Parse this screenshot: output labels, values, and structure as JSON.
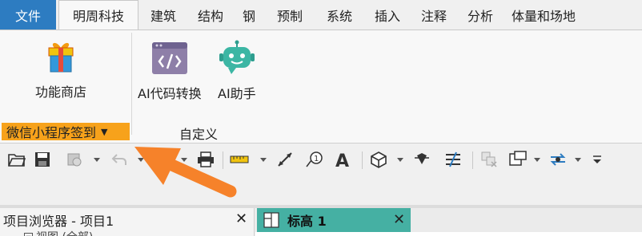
{
  "ribbon": {
    "tabs": [
      "文件",
      "明周科技",
      "建筑",
      "结构",
      "钢",
      "预制",
      "系统",
      "插入",
      "注释",
      "分析",
      "体量和场地"
    ],
    "active_tab": "明周科技"
  },
  "panel": {
    "buttons": [
      {
        "label": "功能商店",
        "icon": "gift-box-icon"
      },
      {
        "label": "AI代码转换",
        "icon": "code-window-icon"
      },
      {
        "label": "AI助手",
        "icon": "robot-icon"
      }
    ],
    "group_orange_label": "微信小程序签到",
    "group_label": "自定义"
  },
  "qat": {
    "icons": [
      "open-folder-icon",
      "save-icon",
      "sync-icon",
      "undo-icon",
      "redo-icon",
      "print-icon",
      "measure-icon",
      "dimension-icon",
      "tag-icon",
      "text-icon",
      "3d-view-icon",
      "section-icon",
      "thin-lines-icon",
      "close-hidden-icon",
      "switch-windows-icon",
      "user-interface-icon"
    ]
  },
  "browser": {
    "title": "项目浏览器 - 项目1",
    "row_label": "视图 (全部)",
    "close": "✕"
  },
  "document": {
    "tab_label": "标高 1",
    "close": "✕"
  },
  "colors": {
    "file_tab": "#2d7cc1",
    "orange_label": "#f7a21b",
    "doc_tab": "#45b0a3",
    "arrow": "#f6822a"
  }
}
